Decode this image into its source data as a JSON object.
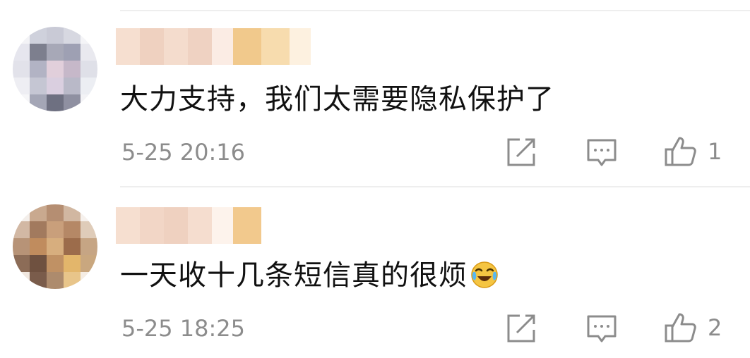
{
  "comments": [
    {
      "text": "大力支持，我们太需要隐私保护了",
      "time": "5-25 20:16",
      "likes": "1",
      "emoji": ""
    },
    {
      "text": "一天收十几条短信真的很烦",
      "time": "5-25 18:25",
      "likes": "2",
      "emoji": "laughing-crying-emoji"
    }
  ],
  "icons": {
    "share": "share-edit-icon",
    "reply": "comment-icon",
    "like": "thumbs-up-icon"
  },
  "colors": {
    "text": "#111111",
    "meta": "#8c8c8c",
    "icon": "#8c8c8c",
    "divider": "#eeeeee"
  }
}
